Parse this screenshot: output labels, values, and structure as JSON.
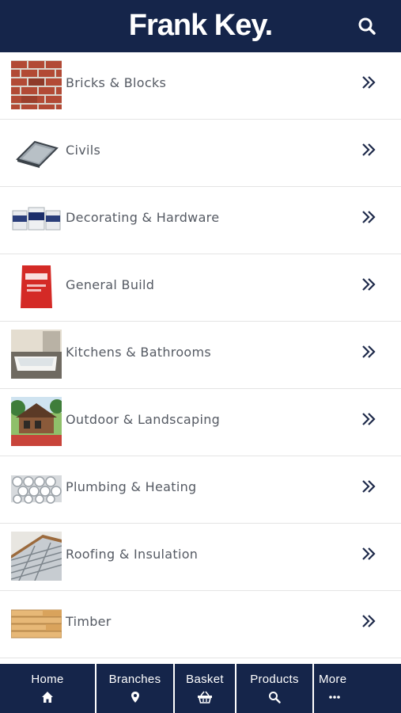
{
  "header": {
    "logo_text": "Frank Key.",
    "search_icon": "search-icon"
  },
  "categories": [
    {
      "label": "Bricks & Blocks",
      "image": "bricks-image"
    },
    {
      "label": "Civils",
      "image": "manhole-cover-image"
    },
    {
      "label": "Decorating & Hardware",
      "image": "paint-tins-image"
    },
    {
      "label": "General Build",
      "image": "cement-bag-image"
    },
    {
      "label": "Kitchens & Bathrooms",
      "image": "bathtub-image"
    },
    {
      "label": "Outdoor & Landscaping",
      "image": "garden-building-image"
    },
    {
      "label": "Plumbing & Heating",
      "image": "pipes-image"
    },
    {
      "label": "Roofing & Insulation",
      "image": "roof-image"
    },
    {
      "label": "Timber",
      "image": "timber-image"
    }
  ],
  "bottom_nav": [
    {
      "label": "Home",
      "icon": "home-icon"
    },
    {
      "label": "Branches",
      "icon": "map-marker-icon"
    },
    {
      "label": "Basket",
      "icon": "basket-icon"
    },
    {
      "label": "Products",
      "icon": "search-icon"
    },
    {
      "label": "More",
      "icon": "more-icon"
    }
  ],
  "colors": {
    "header_bg": "#15254a",
    "text": "#555a63",
    "chevron": "#1e2a4a"
  }
}
